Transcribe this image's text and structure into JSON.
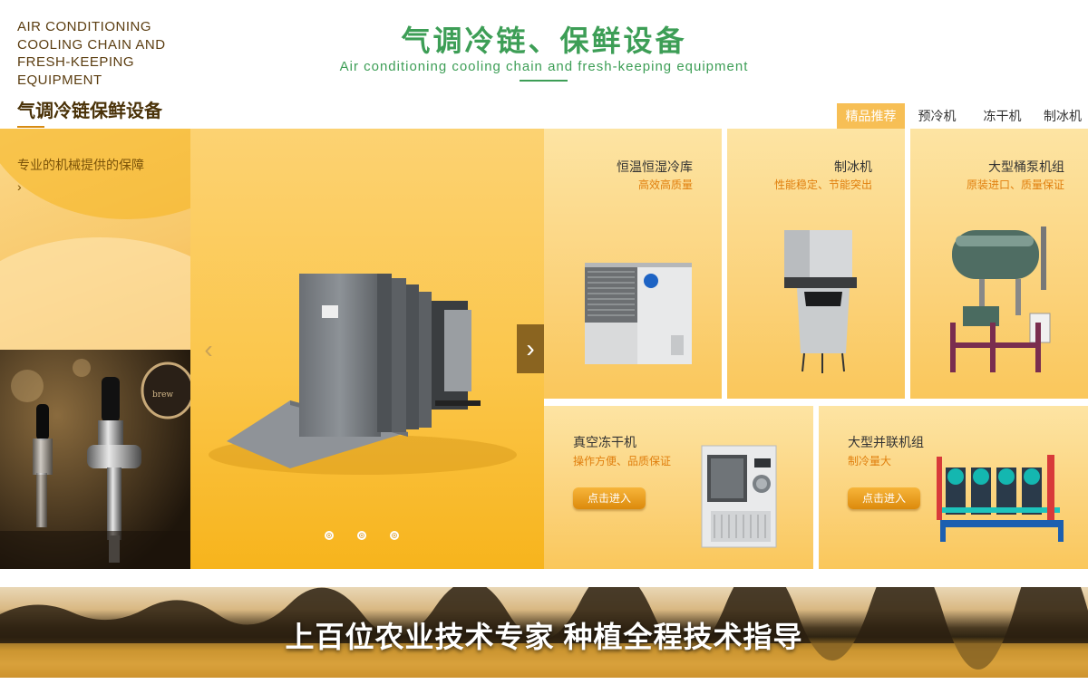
{
  "header": {
    "title": "气调冷链、保鲜设备",
    "subtitle": "Air conditioning cooling chain and fresh-keeping equipment"
  },
  "tabs": [
    {
      "label": "精品推荐",
      "active": true
    },
    {
      "label": "预冷机",
      "active": false
    },
    {
      "label": "冻干机",
      "active": false
    },
    {
      "label": "制冰机",
      "active": false
    }
  ],
  "intro": {
    "title_en": "AIR CONDITIONING COOLING CHAIN AND FRESH-KEEPING EQUIPMENT",
    "title_cn": "气调冷链保鲜设备",
    "desc": "专业的机械提供的保障",
    "arrow": "›"
  },
  "slider": {
    "prev_icon": "chevron-left-icon",
    "next_icon": "chevron-right-icon",
    "prev_glyph": "‹",
    "next_glyph": "›",
    "dots": 3,
    "active_dot": 0
  },
  "products": [
    {
      "name": "恒温恒湿冷库",
      "sub": "高效高质量"
    },
    {
      "name": "制冰机",
      "sub": "性能稳定、节能突出"
    },
    {
      "name": "大型桶泵机组",
      "sub": "原装进口、质量保证"
    },
    {
      "name": "真空冻干机",
      "sub": "操作方便、品质保证",
      "button": "点击进入"
    },
    {
      "name": "大型并联机组",
      "sub": "制冷量大",
      "button": "点击进入"
    }
  ],
  "banner": {
    "text": "上百位农业技术专家 种植全程技术指导"
  },
  "colors": {
    "accent_green": "#3d9e56",
    "tab_active": "#f7bf55",
    "subtitle_orange": "#e07f0e",
    "slider_yellow": "#fbc64b"
  }
}
